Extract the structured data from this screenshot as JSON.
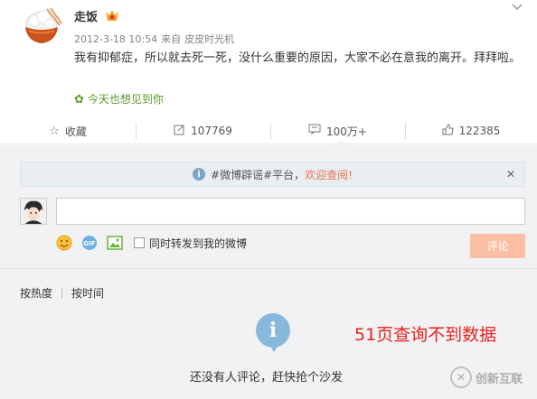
{
  "post": {
    "username": "走饭",
    "timestamp": "2012-3-18 10:54",
    "source_prefix": "来自",
    "source": "皮皮时光机",
    "content": "我有抑郁症，所以就去死一死，没什么重要的原因，大家不必在意我的离开。拜拜啦。",
    "status": "今天也想见到你"
  },
  "actions": {
    "favorite": "收藏",
    "repost": "107769",
    "comment": "100万+",
    "like": "122385"
  },
  "notice": {
    "prefix": "#微博辟谣#平台，",
    "link": "欢迎查阅!"
  },
  "comment_box": {
    "placeholder": "",
    "repost_label": "同时转发到我的微博",
    "submit_label": "评论"
  },
  "sort": {
    "by_hot": "按热度",
    "by_time": "按时间"
  },
  "empty": {
    "message": "还没有人评论，赶快抢个沙发"
  },
  "annotation": "51页查询不到数据",
  "watermark": {
    "text": "创新互联"
  },
  "colors": {
    "accent": "#eb7350",
    "submit_disabled": "#fbbfa5",
    "status_green": "#5c9a2e",
    "annotation_red": "#e8221c",
    "info_blue": "#88b8db"
  }
}
